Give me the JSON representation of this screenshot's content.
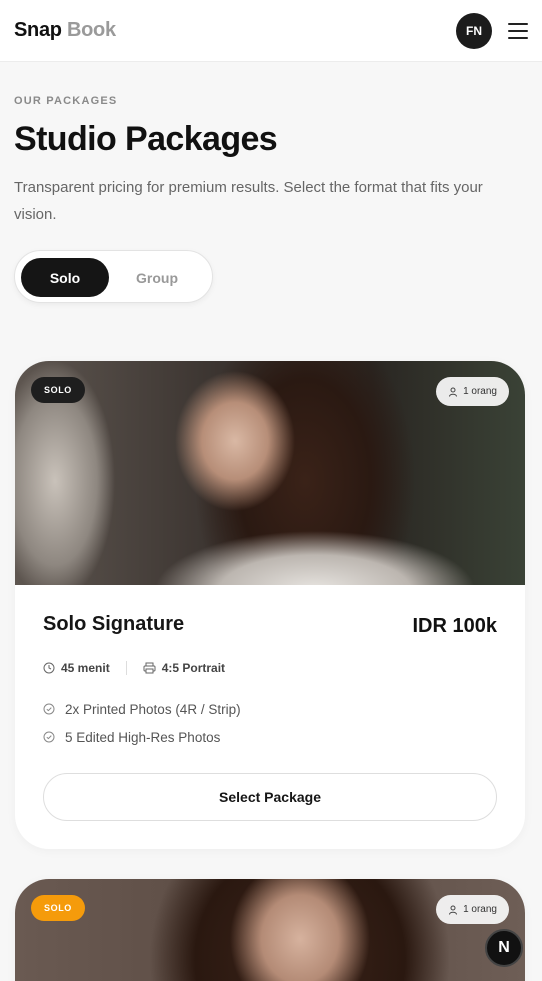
{
  "header": {
    "logo_primary": "Snap",
    "logo_secondary": "Book",
    "avatar_initials": "FN"
  },
  "intro": {
    "eyebrow": "OUR PACKAGES",
    "title": "Studio Packages",
    "subtitle": "Transparent pricing for premium results. Select the format that fits your vision."
  },
  "toggle": {
    "options": [
      "Solo",
      "Group"
    ],
    "selected": "Solo"
  },
  "packages": [
    {
      "type_badge": "SOLO",
      "people": "1 orang",
      "name": "Solo Signature",
      "price": "IDR 100k",
      "duration": "45 menit",
      "format": "4:5 Portrait",
      "features": [
        "2x Printed Photos (4R / Strip)",
        "5 Edited High-Res Photos"
      ],
      "button_label": "Select Package"
    },
    {
      "type_badge": "SOLO",
      "people": "1 orang"
    }
  ],
  "fab_label": "N",
  "colors": {
    "accent_dark": "#151515",
    "badge_orange": "#f59b0b",
    "background": "#f7f7f7"
  }
}
